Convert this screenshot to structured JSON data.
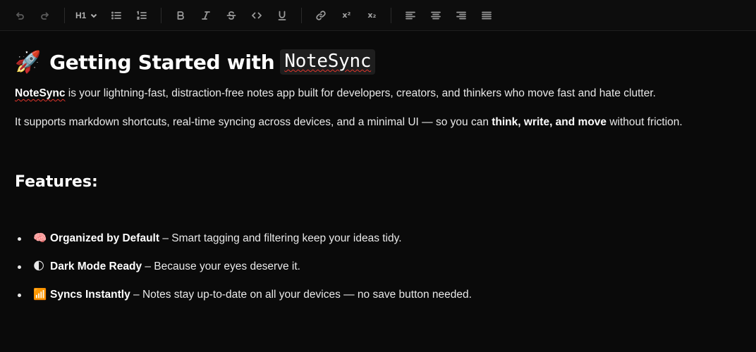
{
  "toolbar": {
    "heading_label": "H1",
    "superscript_label": "x²",
    "subscript_label": "x₂",
    "icons": [
      "undo-icon",
      "redo-icon",
      "chevron-down-icon",
      "bullet-list-icon",
      "ordered-list-icon",
      "bold-icon",
      "italic-icon",
      "strikethrough-icon",
      "code-icon",
      "underline-icon",
      "link-icon",
      "superscript-icon",
      "subscript-icon",
      "align-left-icon",
      "align-center-icon",
      "align-right-icon",
      "align-justify-icon"
    ]
  },
  "doc": {
    "title_emoji": "🚀",
    "title_text": "Getting Started with",
    "title_code": "NoteSync",
    "p1_brand": "NoteSync",
    "p1_rest": " is your lightning-fast, distraction-free notes app built for developers, creators, and thinkers who move fast and hate clutter.",
    "p2_pre": "It supports markdown shortcuts, real-time syncing across devices, and a minimal UI — so you can ",
    "p2_bold": "think, write, and move",
    "p2_post": " without friction.",
    "features_heading": "Features:",
    "features": [
      {
        "emoji": "🧠",
        "title": "Organized by Default",
        "desc": " – Smart tagging and filtering keep your ideas tidy."
      },
      {
        "emoji": "🌓",
        "title": "Dark Mode Ready",
        "desc": " – Because your eyes deserve it."
      },
      {
        "emoji": "📶",
        "title": "Syncs Instantly",
        "desc": " – Notes stay up-to-date on all your devices — no save button needed."
      }
    ]
  },
  "colors": {
    "background": "#0a0a0a",
    "toolbar": "#0d0d0d",
    "spellcheck": "#e0342b",
    "code_bg": "#1e1e1e"
  }
}
